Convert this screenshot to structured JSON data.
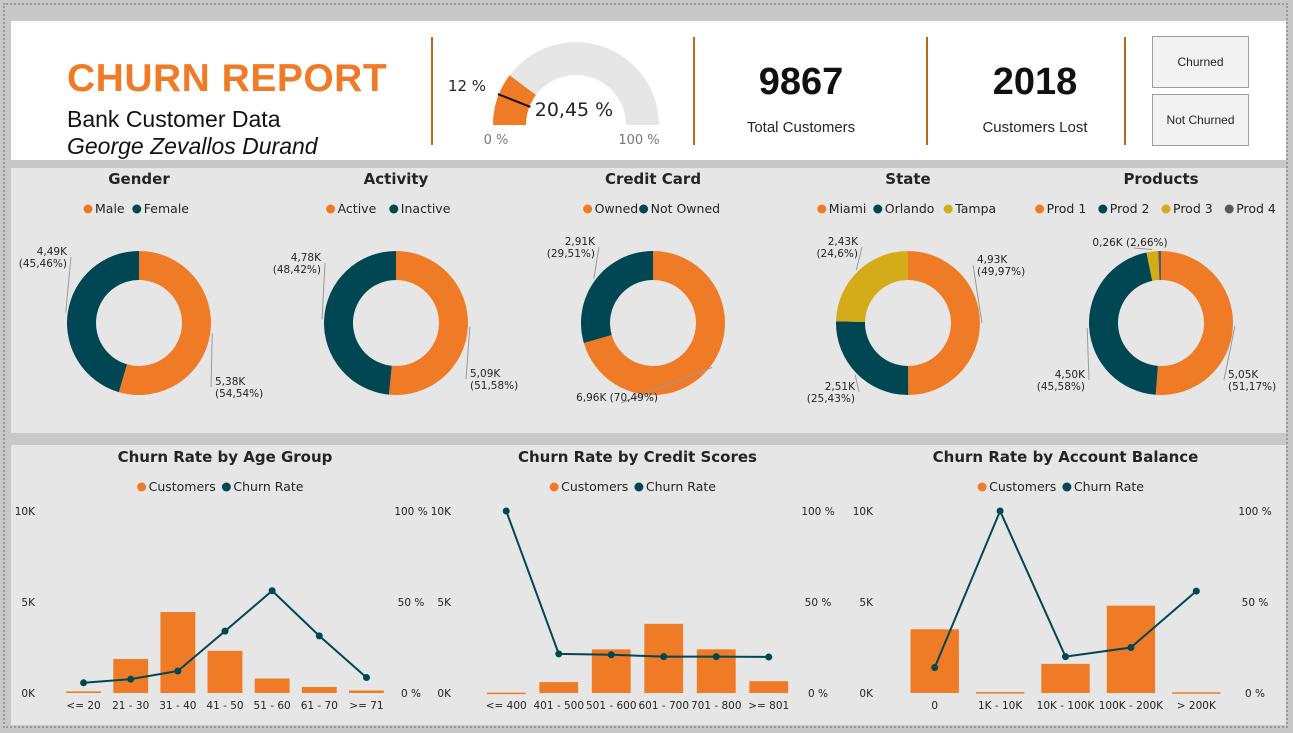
{
  "header": {
    "title": "CHURN REPORT",
    "subtitle": "Bank Customer Data",
    "author": "George Zevallos Durand"
  },
  "gauge": {
    "value_label": "20,45 %",
    "target_label": "12 %",
    "min_label": "0 %",
    "max_label": "100 %",
    "value": 20.45,
    "target": 12,
    "min": 0,
    "max": 100
  },
  "kpis": [
    {
      "value": "9867",
      "label": "Total Customers"
    },
    {
      "value": "2018",
      "label": "Customers Lost"
    }
  ],
  "slicer": {
    "options": [
      "Churned",
      "Not Churned"
    ]
  },
  "colors": {
    "orange": "#f07b26",
    "teal": "#004753",
    "gold": "#d4ac19",
    "gray": "#5a5a5a",
    "gauge_track": "#e6e6e6",
    "divider": "#b86a1c"
  },
  "chart_data": [
    {
      "type": "pie",
      "title": "Gender",
      "legend": [
        "Male",
        "Female"
      ],
      "slices": [
        {
          "name": "Male",
          "value": 5.38,
          "label": "5,38K\n(54,54%)",
          "color": "#f07b26"
        },
        {
          "name": "Female",
          "value": 4.49,
          "label": "4,49K\n(45,46%)",
          "color": "#004753"
        }
      ]
    },
    {
      "type": "pie",
      "title": "Activity",
      "legend": [
        "Active",
        "Inactive"
      ],
      "slices": [
        {
          "name": "Active",
          "value": 5.09,
          "label": "5,09K\n(51,58%)",
          "color": "#f07b26"
        },
        {
          "name": "Inactive",
          "value": 4.78,
          "label": "4,78K\n(48,42%)",
          "color": "#004753"
        }
      ]
    },
    {
      "type": "pie",
      "title": "Credit Card",
      "legend": [
        "Owned",
        "Not Owned"
      ],
      "slices": [
        {
          "name": "Owned",
          "value": 6.96,
          "label": "6,96K (70,49%)",
          "color": "#f07b26"
        },
        {
          "name": "Not Owned",
          "value": 2.91,
          "label": "2,91K\n(29,51%)",
          "color": "#004753"
        }
      ]
    },
    {
      "type": "pie",
      "title": "State",
      "legend": [
        "Miami",
        "Orlando",
        "Tampa"
      ],
      "slices": [
        {
          "name": "Miami",
          "value": 4.93,
          "label": "4,93K\n(49,97%)",
          "color": "#f07b26"
        },
        {
          "name": "Orlando",
          "value": 2.51,
          "label": "2,51K\n(25,43%)",
          "color": "#004753"
        },
        {
          "name": "Tampa",
          "value": 2.43,
          "label": "2,43K\n(24,6%)",
          "color": "#d4ac19"
        }
      ]
    },
    {
      "type": "pie",
      "title": "Products",
      "legend": [
        "Prod 1",
        "Prod 2",
        "Prod 3",
        "Prod 4"
      ],
      "slices": [
        {
          "name": "Prod 1",
          "value": 5.05,
          "label": "5,05K\n(51,17%)",
          "color": "#f07b26"
        },
        {
          "name": "Prod 2",
          "value": 4.5,
          "label": "4,50K\n(45,58%)",
          "color": "#004753"
        },
        {
          "name": "Prod 3",
          "value": 0.26,
          "label": "0,26K (2,66%)",
          "color": "#d4ac19"
        },
        {
          "name": "Prod 4",
          "value": 0.06,
          "label": "",
          "color": "#5a5a5a"
        }
      ]
    },
    {
      "type": "bar",
      "title": "Churn Rate by Age Group",
      "legend": [
        "Customers",
        "Churn Rate"
      ],
      "categories": [
        "<= 20",
        "21 - 30",
        "31 - 40",
        "41 - 50",
        "51 - 60",
        "61 - 70",
        ">= 71"
      ],
      "series": [
        {
          "name": "Customers",
          "type": "bar",
          "axis": "left",
          "values": [
            89,
            1868,
            4451,
            2320,
            797,
            331,
            136
          ]
        },
        {
          "name": "Churn Rate",
          "type": "line",
          "axis": "right",
          "values": [
            5.6,
            7.6,
            12.1,
            34,
            56.2,
            31.4,
            8.5
          ]
        }
      ],
      "y_left": {
        "ticks": [
          "0K",
          "5K",
          "10K"
        ],
        "range": [
          0,
          10000
        ]
      },
      "y_right": {
        "ticks": [
          "0 %",
          "50 %",
          "100 %"
        ],
        "range": [
          0,
          100
        ]
      }
    },
    {
      "type": "bar",
      "title": "Churn Rate by Credit Scores",
      "legend": [
        "Customers",
        "Churn Rate"
      ],
      "categories": [
        "<= 400",
        "401 - 500",
        "501 - 600",
        "601 - 700",
        "701 - 800",
        ">= 801"
      ],
      "series": [
        {
          "name": "Customers",
          "type": "bar",
          "axis": "left",
          "values": [
            19,
            600,
            2400,
            3800,
            2400,
            650
          ]
        },
        {
          "name": "Churn Rate",
          "type": "line",
          "axis": "right",
          "values": [
            100,
            21.5,
            21,
            20,
            20,
            19.8
          ]
        }
      ],
      "y_left": {
        "ticks": [
          "0K",
          "5K",
          "10K"
        ],
        "range": [
          0,
          10000
        ]
      },
      "y_right": {
        "ticks": [
          "0 %",
          "50 %",
          "100 %"
        ],
        "range": [
          0,
          100
        ]
      }
    },
    {
      "type": "bar",
      "title": "Churn Rate by Account Balance",
      "legend": [
        "Customers",
        "Churn Rate"
      ],
      "categories": [
        "0",
        "1K - 10K",
        "10K - 100K",
        "100K - 200K",
        "> 200K"
      ],
      "series": [
        {
          "name": "Customers",
          "type": "bar",
          "axis": "left",
          "values": [
            3500,
            50,
            1600,
            4800,
            40
          ]
        },
        {
          "name": "Churn Rate",
          "type": "line",
          "axis": "right",
          "values": [
            14,
            100,
            20,
            25,
            56
          ]
        }
      ],
      "y_left": {
        "ticks": [
          "0K",
          "5K",
          "10K"
        ],
        "range": [
          0,
          10000
        ]
      },
      "y_right": {
        "ticks": [
          "0 %",
          "50 %",
          "100 %"
        ],
        "range": [
          0,
          100
        ]
      }
    }
  ]
}
